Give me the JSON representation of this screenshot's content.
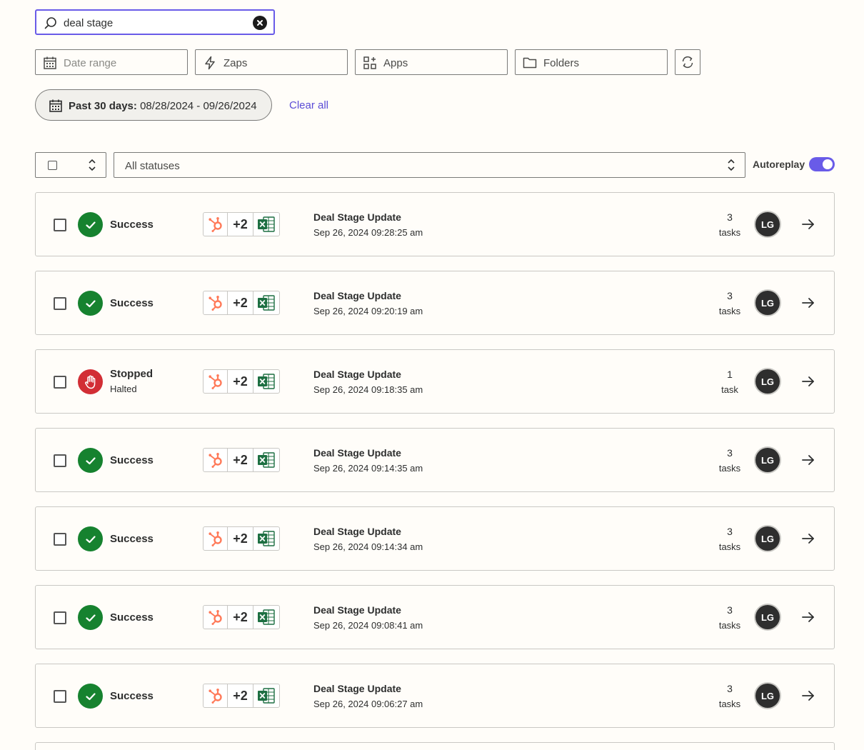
{
  "search": {
    "value": "deal stage"
  },
  "filters": {
    "date_range": "Date range",
    "zaps": "Zaps",
    "apps": "Apps",
    "folders": "Folders"
  },
  "active_filter": {
    "label": "Past 30 days:",
    "value": "08/28/2024 - 09/26/2024"
  },
  "clear_all": "Clear all",
  "status_select": "All statuses",
  "autoreplay": {
    "label": "Autoreplay",
    "enabled": true
  },
  "colors": {
    "accent": "#695be8",
    "success": "#16822f",
    "stopped": "#d22e35",
    "hubspot": "#ff7a59",
    "excel": "#1d6f42"
  },
  "runs": [
    {
      "status": "Success",
      "substatus": "",
      "type": "success",
      "apps_more": "+2",
      "zap": "Deal Stage Update",
      "date": "Sep 26, 2024 09:28:25 am",
      "tasks": "3",
      "tasks_label": "tasks",
      "avatar": "LG"
    },
    {
      "status": "Success",
      "substatus": "",
      "type": "success",
      "apps_more": "+2",
      "zap": "Deal Stage Update",
      "date": "Sep 26, 2024 09:20:19 am",
      "tasks": "3",
      "tasks_label": "tasks",
      "avatar": "LG"
    },
    {
      "status": "Stopped",
      "substatus": "Halted",
      "type": "stopped",
      "apps_more": "+2",
      "zap": "Deal Stage Update",
      "date": "Sep 26, 2024 09:18:35 am",
      "tasks": "1",
      "tasks_label": "task",
      "avatar": "LG"
    },
    {
      "status": "Success",
      "substatus": "",
      "type": "success",
      "apps_more": "+2",
      "zap": "Deal Stage Update",
      "date": "Sep 26, 2024 09:14:35 am",
      "tasks": "3",
      "tasks_label": "tasks",
      "avatar": "LG"
    },
    {
      "status": "Success",
      "substatus": "",
      "type": "success",
      "apps_more": "+2",
      "zap": "Deal Stage Update",
      "date": "Sep 26, 2024 09:14:34 am",
      "tasks": "3",
      "tasks_label": "tasks",
      "avatar": "LG"
    },
    {
      "status": "Success",
      "substatus": "",
      "type": "success",
      "apps_more": "+2",
      "zap": "Deal Stage Update",
      "date": "Sep 26, 2024 09:08:41 am",
      "tasks": "3",
      "tasks_label": "tasks",
      "avatar": "LG"
    },
    {
      "status": "Success",
      "substatus": "",
      "type": "success",
      "apps_more": "+2",
      "zap": "Deal Stage Update",
      "date": "Sep 26, 2024 09:06:27 am",
      "tasks": "3",
      "tasks_label": "tasks",
      "avatar": "LG"
    }
  ]
}
